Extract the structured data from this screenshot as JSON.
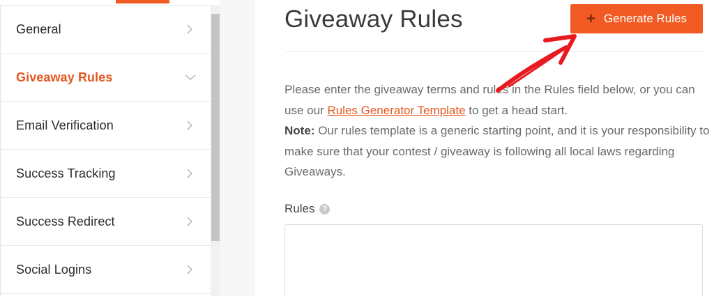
{
  "sidebar": {
    "items": [
      {
        "label": "General",
        "active": false
      },
      {
        "label": "Giveaway Rules",
        "active": true
      },
      {
        "label": "Email Verification",
        "active": false
      },
      {
        "label": "Success Tracking",
        "active": false
      },
      {
        "label": "Success Redirect",
        "active": false
      },
      {
        "label": "Social Logins",
        "active": false
      }
    ]
  },
  "main": {
    "title": "Giveaway Rules",
    "generate_button_label": "Generate Rules",
    "generate_button_icon": "plus-icon",
    "desc_line1_prefix": "Please enter the giveaway terms and rules in the Rules field below, or you can use our",
    "desc_link": "Rules Generator Template",
    "desc_line1_suffix": "to get a head start.",
    "note_label": "Note:",
    "note_text": "Our rules template is a generic starting point, and it is your responsibility to make sure that your contest / giveaway is following all local laws regarding Giveaways.",
    "rules_label": "Rules",
    "rules_help_icon": "question-circle-icon",
    "rules_value": ""
  },
  "colors": {
    "accent": "#f15a22",
    "active_text": "#e4571f",
    "annotation_arrow": "#e8191f"
  }
}
